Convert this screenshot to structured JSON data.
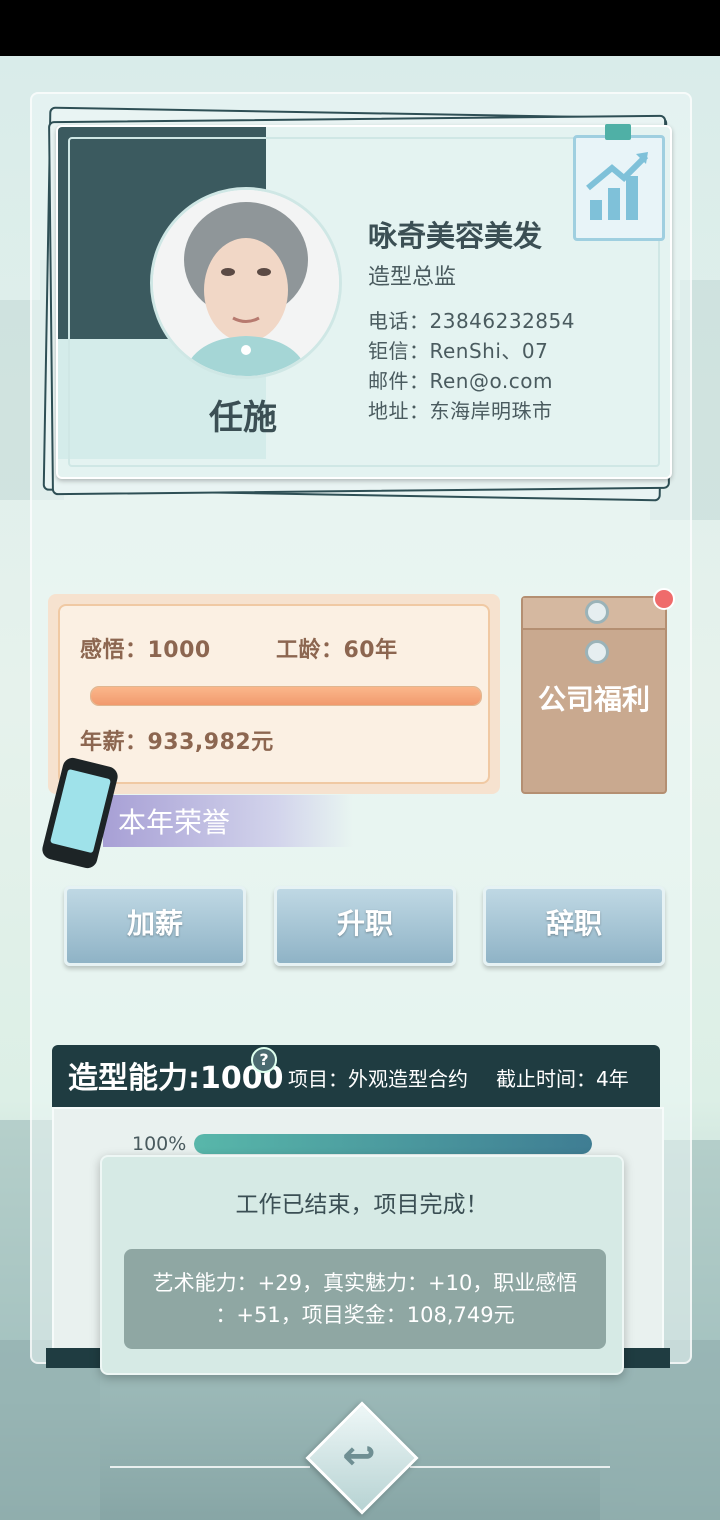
{
  "profile": {
    "name": "任施",
    "company": "咏奇美容美发",
    "position": "造型总监",
    "phone": "电话：23846232854",
    "chat": "钜信：RenShi、07",
    "email": "邮件：Ren@o.com",
    "address": "地址：东海岸明珠市"
  },
  "stats": {
    "insight": "感悟：1000",
    "seniority": "工龄：60年",
    "salary": "年薪：933,982元",
    "bar_fill": 1.0
  },
  "welfare": {
    "label": "公司福利"
  },
  "honor": {
    "label": "本年荣誉"
  },
  "actions": {
    "raise": "加薪",
    "promote": "升职",
    "resign": "辞职"
  },
  "project": {
    "skill": "造型能力:1000",
    "item": "项目：外观造型合约",
    "deadline": "截止时间：4年",
    "progress_text": "100%",
    "progress": 1.0
  },
  "popup": {
    "title": "工作已结束，项目完成！",
    "result_line1": "艺术能力：+29，真实魅力：+10，职业感悟",
    "result_line2": "：+51，项目奖金：108,749元"
  },
  "colors": {
    "accent": "#1f3c41",
    "progress": "#58b7aa",
    "stat_bar": "#f19a6e",
    "notification": "#ef6b6b"
  },
  "icons": {
    "help": "?",
    "back": "return-arrow-icon",
    "chart": "trending-up-chart-icon"
  }
}
